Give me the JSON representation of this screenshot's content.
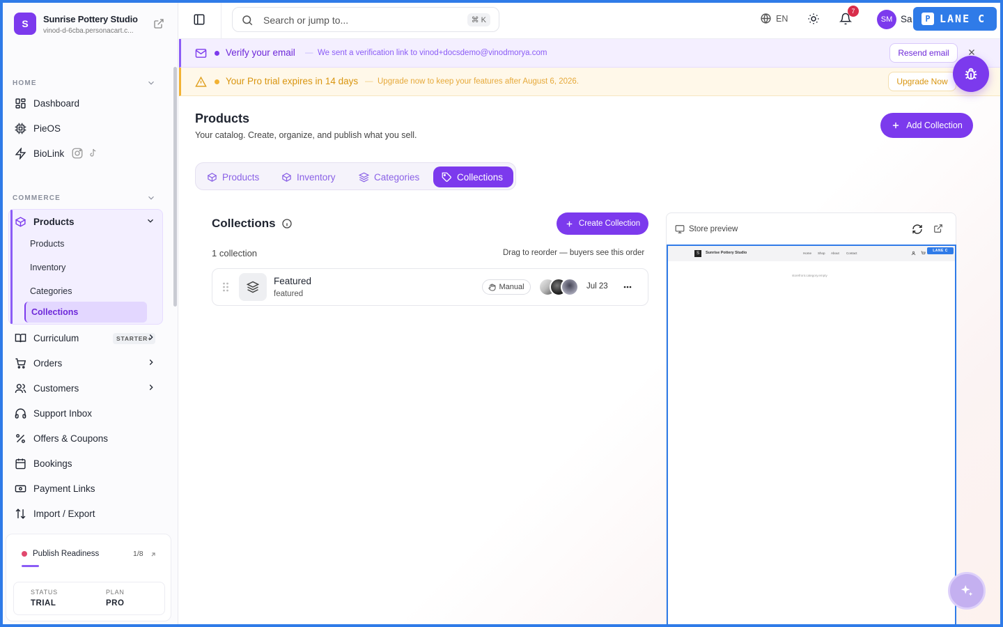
{
  "brand": {
    "initial": "S",
    "name": "Sunrise Pottery Studio",
    "url": "vinod-d-6cba.personacart.c..."
  },
  "sidebar": {
    "home_label": "HOME",
    "home_items": [
      {
        "label": "Dashboard",
        "icon": "dashboard-icon"
      },
      {
        "label": "PieOS",
        "icon": "chip-icon"
      },
      {
        "label": "BioLink",
        "icon": "bolt-icon"
      }
    ],
    "commerce_label": "COMMERCE",
    "products_group": {
      "label": "Products",
      "items": [
        "Products",
        "Inventory",
        "Categories",
        "Collections"
      ],
      "active": "Collections"
    },
    "items": [
      {
        "label": "Curriculum",
        "badge": "STARTER+"
      },
      {
        "label": "Orders"
      },
      {
        "label": "Customers"
      },
      {
        "label": "Support Inbox"
      },
      {
        "label": "Offers & Coupons"
      },
      {
        "label": "Bookings"
      },
      {
        "label": "Payment Links"
      },
      {
        "label": "Import / Export"
      }
    ],
    "readiness": {
      "title": "Publish Readiness",
      "count": "1/8",
      "progress": 0.125,
      "status_label": "STATUS",
      "status_value": "TRIAL",
      "plan_label": "PLAN",
      "plan_value": "PRO"
    }
  },
  "topbar": {
    "search_placeholder": "Search or jump to...",
    "search_shortcut": "⌘ K",
    "language": "EN",
    "notification_count": "7",
    "avatar_initials": "SM",
    "user_name_partial": "Sa",
    "lane_label": "LANE C",
    "lane_badge": "P"
  },
  "banners": {
    "verify": {
      "title": "Verify your email",
      "separator": "—",
      "message": "We sent a verification link to vinod+docsdemo@vinodmorya.com",
      "button": "Resend email",
      "color": "#7c3aed"
    },
    "trial": {
      "title": "Your Pro trial expires in 14 days",
      "separator": "—",
      "message": "Upgrade now to keep your features after August 6, 2026.",
      "button": "Upgrade Now",
      "color": "#f2b233"
    }
  },
  "page": {
    "title": "Products",
    "subtitle": "Your catalog. Create, organize, and publish what you sell.",
    "add_button": "Add Collection",
    "tabs": [
      "Products",
      "Inventory",
      "Categories",
      "Collections"
    ],
    "active_tab": "Collections"
  },
  "collections": {
    "title": "Collections",
    "create_button": "Create Collection",
    "count_text": "1 collection",
    "drag_hint": "Drag to reorder — buyers see this order",
    "rows": [
      {
        "name": "Featured",
        "slug": "featured",
        "mode": "Manual",
        "date": "Jul 23"
      }
    ]
  },
  "preview": {
    "title": "Store preview",
    "site_initial": "S",
    "site_name": "Sunrise Pottery Studio",
    "nav_links": [
      "Home",
      "Shop",
      "About",
      "Contact"
    ],
    "empty_text": "storefront.category.empty",
    "lane_label": "LANE C"
  },
  "colors": {
    "accent": "#7c3aed",
    "lane_blue": "#2f7be8",
    "warning": "#f2b233",
    "danger": "#d92d4b"
  }
}
